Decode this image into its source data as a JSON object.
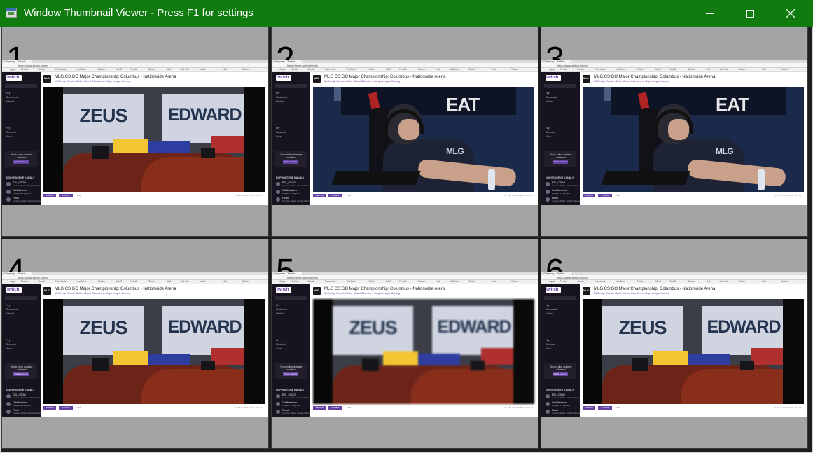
{
  "window": {
    "title": "Window Thumbnail Viewer - Press F1 for settings",
    "controls": {
      "minimize": "minimize",
      "maximize": "maximize",
      "close": "close"
    },
    "accent_color": "#107c10"
  },
  "cells": [
    {
      "number": "1",
      "scene": "desk"
    },
    {
      "number": "2",
      "scene": "player"
    },
    {
      "number": "3",
      "scene": "player"
    },
    {
      "number": "4",
      "scene": "desk"
    },
    {
      "number": "5",
      "scene": "desk-blurred"
    },
    {
      "number": "6",
      "scene": "desk"
    }
  ],
  "thumbnail": {
    "tab_title": "Odyssey - Twitch",
    "url": "https://www.twitch.tv/mlg",
    "bookmarks": [
      "Apps",
      "Firefox",
      "Gmail",
      "Facebook",
      "YouTube",
      "Twitter",
      "MLG",
      "Reddit",
      "Steam",
      "Lidl",
      "Lidl Info",
      "Twitch",
      "Lidl",
      "Twitch"
    ],
    "twitch": {
      "logo": "twitch",
      "search_placeholder": "Hledat",
      "menu_top": [
        "Hry",
        "Sledované",
        "Náhled"
      ],
      "menu_mid": [
        "Hry",
        "Sledovat",
        "Akce"
      ],
      "promo_text": "Nová edice dostane odměnu!",
      "promo_button": "Získat odměnu",
      "recommended_label": "DOPORUČENÉ KANÁLY",
      "channels": [
        {
          "name": "ESL_CSGO",
          "sub": "Counter-Strike: Global Offensive"
        },
        {
          "name": "OddMarshmo",
          "sub": "League of Legends"
        },
        {
          "name": "Flood",
          "sub": "Counter-Strike: Global Offensive"
        }
      ],
      "channel_logo": "MLG",
      "stream_title": "MLG CS:GO Major Championship: Columbus - Nationwide Arena",
      "stream_sub": "MLG hraje Counter-Strike: Global Offensive ve Major League Gaming",
      "follow_label": "Sledovat",
      "share_label": "Přihlásit",
      "more_label": "Více",
      "stats": "87 195 · 40 522 300 · 587 761"
    },
    "scene_text": {
      "sign_left": "ZEUS",
      "sign_right": "EDWARD",
      "banner": "EAT",
      "jersey": "MLG"
    }
  }
}
